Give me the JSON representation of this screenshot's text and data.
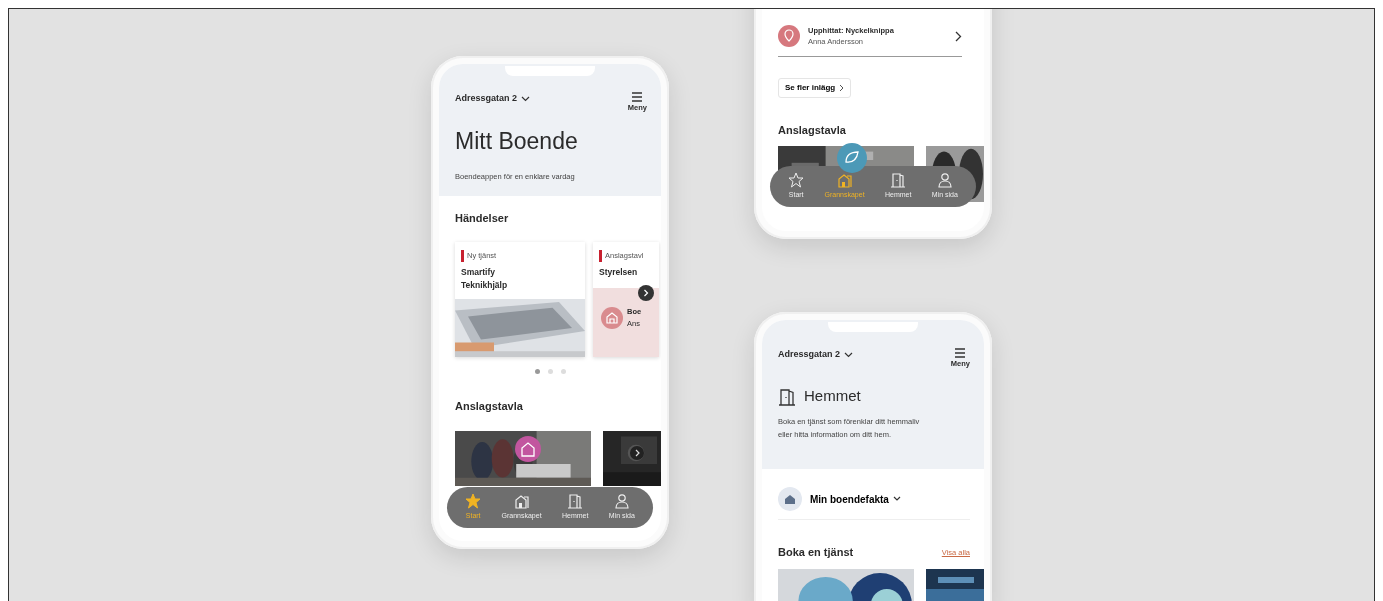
{
  "phone_1": {
    "address": "Adressgatan 2",
    "menu_label": "Meny",
    "title": "Mitt Boende",
    "subtitle": "Boendeappen för en enklare vardag",
    "events_heading": "Händelser",
    "event_cards": [
      {
        "kind": "service",
        "tag": "Ny tjänst",
        "title": "Smartify Teknikhjälp"
      },
      {
        "kind": "notice",
        "tag": "Anslagstavl",
        "title": "Styrelsen",
        "line_1": "Boe",
        "line_2": "Ans"
      }
    ],
    "dots": [
      {
        "selected": true
      },
      {
        "selected": false
      },
      {
        "selected": false
      }
    ],
    "board_heading": "Anslagstavla",
    "nav": [
      {
        "label": "Start",
        "selected": true
      },
      {
        "label": "Grannskapet",
        "selected": false
      },
      {
        "label": "Hemmet",
        "selected": false
      },
      {
        "label": "Min sida",
        "selected": false
      }
    ]
  },
  "phone_2": {
    "post": {
      "title": "Upphittat: Nyckelknippa",
      "author": "Anna Andersson"
    },
    "more_button": "Se fler inlägg",
    "board_heading": "Anslagstavla",
    "nav": [
      {
        "label": "Start",
        "selected": false
      },
      {
        "label": "Grannskapet",
        "selected": true
      },
      {
        "label": "Hemmet",
        "selected": false
      },
      {
        "label": "Min sida",
        "selected": false
      }
    ]
  },
  "phone_3": {
    "address": "Adressgatan 2",
    "menu_label": "Meny",
    "title": "Hemmet",
    "description": "Boka en tjänst som förenklar ditt hemmaliv eller hitta information om ditt hem.",
    "facts_label": "Min boendefakta",
    "services_heading": "Boka en tjänst",
    "see_all": "Visa alla"
  }
}
